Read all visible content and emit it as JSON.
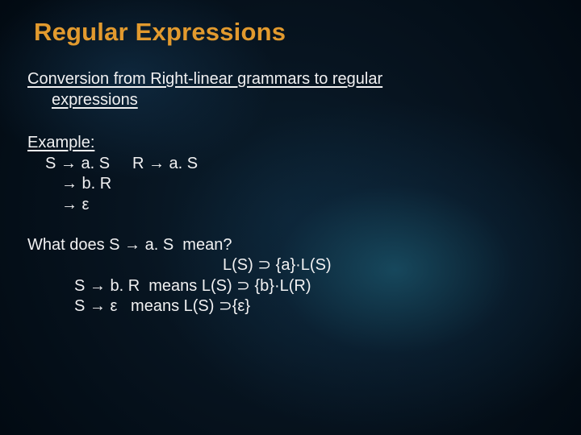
{
  "title": "Regular Expressions",
  "section_heading": "Conversion from Right-linear grammars to regular expressions",
  "example_label": "Example:",
  "grammar": {
    "s_rule1": "S → a. S",
    "r_rule1": "R → a. S",
    "s_rule2": "→ b. R",
    "s_rule3": "→ ε"
  },
  "meaning": {
    "q": "What does S → a. S  mean?",
    "line1": "L(S) ⊃ {a}·L(S)",
    "line2": "S → b. R  means L(S) ⊃ {b}·L(R)",
    "line3": "S → ε   means L(S) ⊃{ε}"
  }
}
